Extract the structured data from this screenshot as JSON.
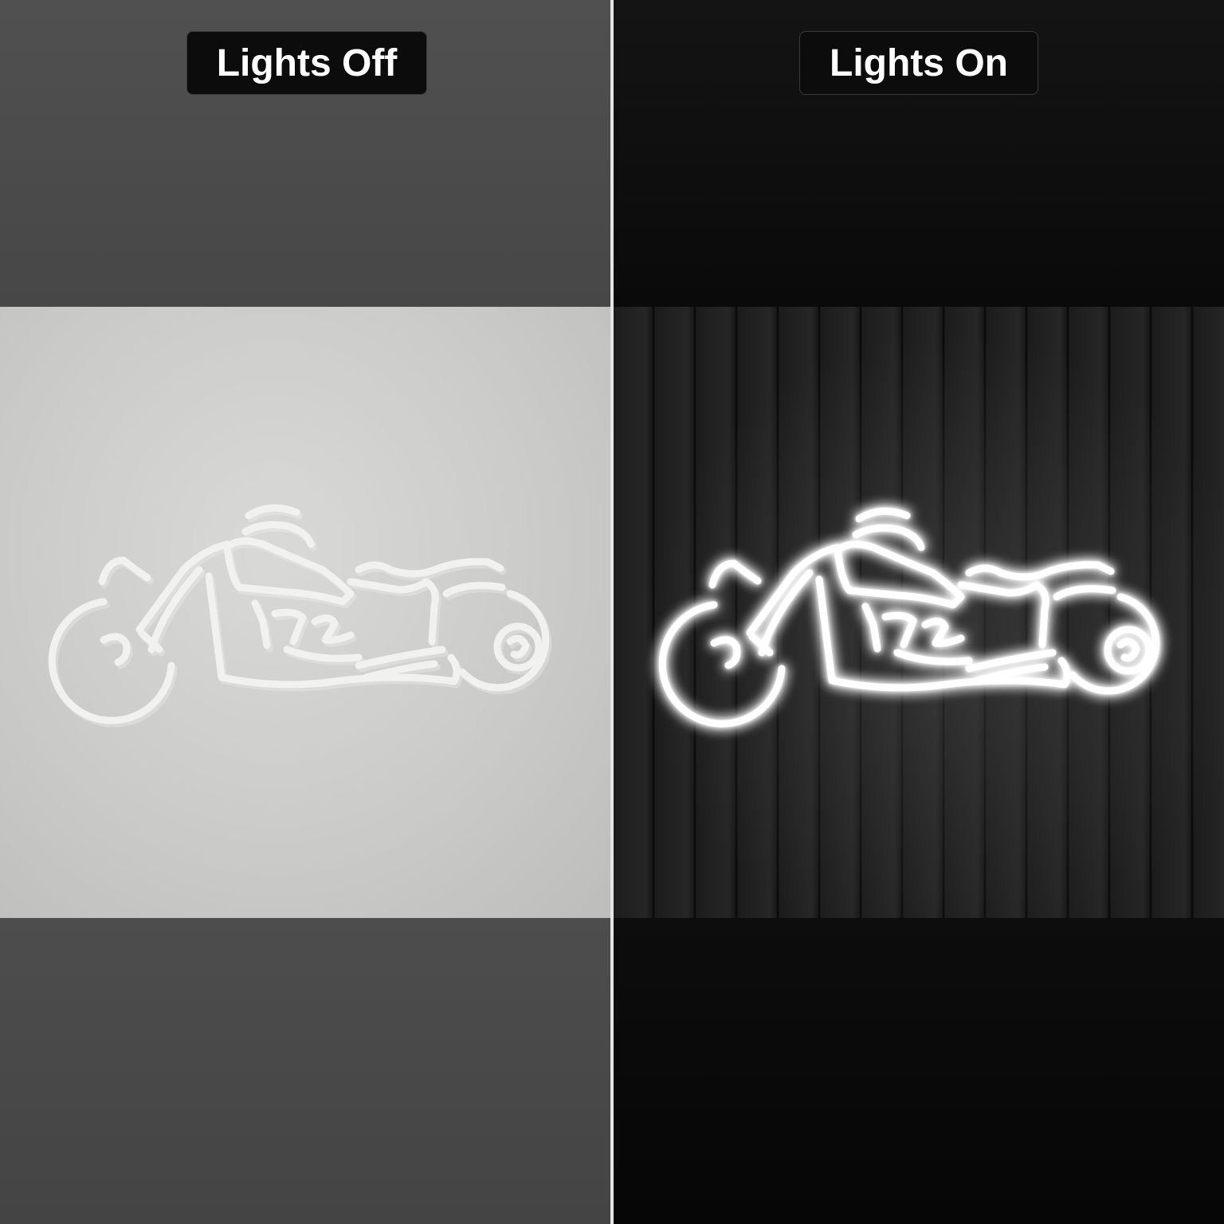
{
  "panels": {
    "off": {
      "label": "Lights Off"
    },
    "on": {
      "label": "Lights On"
    }
  },
  "colors": {
    "wall_off": "#cbcbc9",
    "wall_on": "#1c1c1c",
    "tube_off": "#f1f1ef",
    "tube_on": "#ffffff",
    "label_bg": "#0c0c0c",
    "label_text": "#ffffff"
  }
}
